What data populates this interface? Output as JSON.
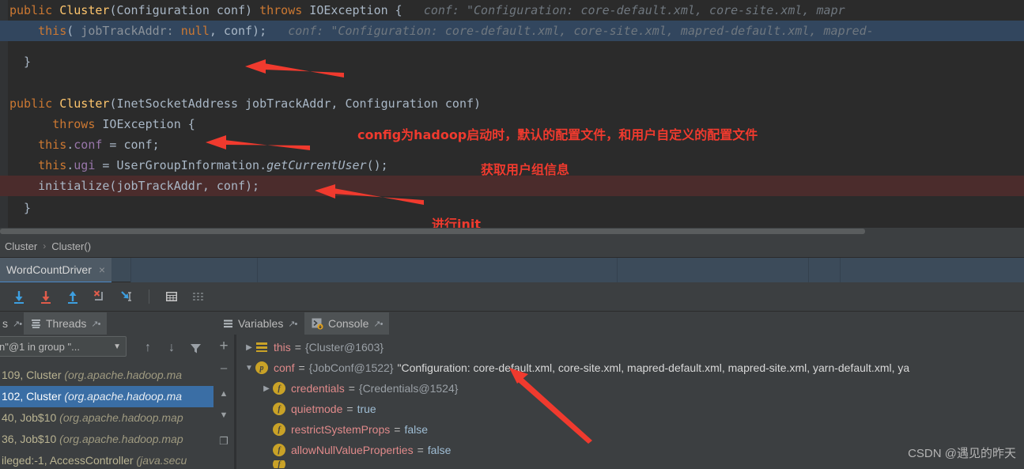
{
  "editor": {
    "lines": [
      {
        "id": "l1",
        "state": "normal",
        "text": "public Cluster(Configuration conf) throws IOException {"
      },
      {
        "id": "l2",
        "state": "selected",
        "text": "  this( jobTrackAddr: null, conf);"
      },
      {
        "id": "l3",
        "state": "normal",
        "text": "}"
      },
      {
        "id": "l4",
        "state": "normal",
        "text": ""
      },
      {
        "id": "l5",
        "state": "normal",
        "text": "public Cluster(InetSocketAddress jobTrackAddr, Configuration conf)"
      },
      {
        "id": "l6",
        "state": "normal",
        "text": "    throws IOException {"
      },
      {
        "id": "l7",
        "state": "normal",
        "text": "  this.conf = conf;"
      },
      {
        "id": "l8",
        "state": "normal",
        "text": "  this.ugi = UserGroupInformation.getCurrentUser();"
      },
      {
        "id": "l9",
        "state": "breakpoint",
        "text": "  initialize(jobTrackAddr, conf);"
      },
      {
        "id": "l10",
        "state": "normal",
        "text": "}"
      }
    ],
    "inline_hint_1": "conf: \"Configuration: core-default.xml, core-site.xml, mapr",
    "inline_hint_2": "conf: \"Configuration: core-default.xml, core-site.xml, mapred-default.xml, mapred-",
    "annotations": [
      {
        "id": "a1",
        "text": "config为hadoop启动时，默认的配置文件，和用户自定义的配置文件"
      },
      {
        "id": "a2",
        "text": "获取用户组信息"
      },
      {
        "id": "a3",
        "text": "进行init"
      }
    ]
  },
  "breadcrumb": {
    "items": [
      "Cluster",
      "Cluster()"
    ],
    "separator": "›"
  },
  "run_tab": {
    "label": "WordCountDriver",
    "close_icon": "×"
  },
  "debug_toolbar": {
    "buttons": [
      {
        "name": "step-over-icon",
        "glyph": "↓",
        "color": "#3d9fe0"
      },
      {
        "name": "step-into-icon",
        "glyph": "↓",
        "color": "#e05c4b"
      },
      {
        "name": "force-step-into-icon",
        "glyph": "↑",
        "color": "#3d9fe0"
      },
      {
        "name": "step-out-icon",
        "glyph": "✗",
        "color": "#e05c4b"
      },
      {
        "name": "run-to-cursor-icon",
        "glyph": "↘",
        "color": "#3d9fe0"
      },
      {
        "name": "evaluate-expression-icon",
        "glyph": "▦",
        "color": "#c4c4c4"
      },
      {
        "name": "trace-settings-icon",
        "glyph": "≡",
        "color": "#6f7477"
      }
    ]
  },
  "panel_tabs": [
    {
      "id": "frames-tab",
      "label": "s",
      "icon": "pin",
      "active": false
    },
    {
      "id": "threads-tab",
      "label": "Threads",
      "icon": "threads-icon",
      "active": true
    },
    {
      "id": "variables-tab",
      "label": "Variables",
      "icon": "variables-icon",
      "active": false
    },
    {
      "id": "console-tab",
      "label": "Console",
      "icon": "console-icon",
      "active": true
    }
  ],
  "frames": {
    "thread_selector_value": "n\"@1 in group \"...",
    "dropdown_icon": "▼",
    "toolbar_icons": [
      {
        "name": "frame-up-icon",
        "glyph": "↑"
      },
      {
        "name": "frame-down-icon",
        "glyph": "↓"
      },
      {
        "name": "filter-icon",
        "glyph": "∇"
      }
    ],
    "rows": [
      {
        "id": "f1",
        "selected": false,
        "text": "109, Cluster ",
        "pkg": "(org.apache.hadoop.ma"
      },
      {
        "id": "f2",
        "selected": true,
        "text": "102, Cluster ",
        "pkg": "(org.apache.hadoop.ma"
      },
      {
        "id": "f3",
        "selected": false,
        "text": "40, Job$10 ",
        "pkg": "(org.apache.hadoop.map"
      },
      {
        "id": "f4",
        "selected": false,
        "text": "36, Job$10 ",
        "pkg": "(org.apache.hadoop.map"
      },
      {
        "id": "f5",
        "selected": false,
        "text": "ileged:-1, AccessController ",
        "pkg": "(java.secu"
      }
    ]
  },
  "frames_side_toolbar": [
    {
      "name": "add-watch-icon",
      "glyph": "+"
    },
    {
      "name": "remove-watch-icon",
      "glyph": "–"
    },
    {
      "name": "move-up-icon",
      "glyph": "▲"
    },
    {
      "name": "move-down-icon",
      "glyph": "▼"
    },
    {
      "name": "copy-icon",
      "glyph": "❐"
    }
  ],
  "variables": {
    "rows": [
      {
        "id": "v1",
        "indent": 0,
        "twisty": "▶",
        "icon": "stack",
        "icon_letter": "",
        "name": "this",
        "eq": "=",
        "ref": "{Cluster@1603}",
        "str": ""
      },
      {
        "id": "v2",
        "indent": 0,
        "twisty": "▼",
        "icon": "p",
        "icon_letter": "p",
        "name": "conf",
        "eq": "=",
        "ref": "{JobConf@1522}",
        "str": "\"Configuration: core-default.xml, core-site.xml, mapred-default.xml, mapred-site.xml, yarn-default.xml, ya"
      },
      {
        "id": "v3",
        "indent": 1,
        "twisty": "▶",
        "icon": "f",
        "icon_letter": "f",
        "name": "credentials",
        "eq": "=",
        "ref": "{Credentials@1524}",
        "str": ""
      },
      {
        "id": "v4",
        "indent": 1,
        "twisty": "",
        "icon": "f",
        "icon_letter": "f",
        "name": "quietmode",
        "eq": "=",
        "ref": "",
        "bool": "true"
      },
      {
        "id": "v5",
        "indent": 1,
        "twisty": "",
        "icon": "f",
        "icon_letter": "f",
        "name": "restrictSystemProps",
        "eq": "=",
        "ref": "",
        "bool": "false"
      },
      {
        "id": "v6",
        "indent": 1,
        "twisty": "",
        "icon": "f",
        "icon_letter": "f",
        "name": "allowNullValueProperties",
        "eq": "=",
        "ref": "",
        "bool": "false"
      },
      {
        "id": "v7",
        "indent": 1,
        "twisty": "",
        "icon": "f",
        "icon_letter": "f",
        "name": "",
        "eq": "",
        "ref": "",
        "bool": ""
      }
    ]
  },
  "watermark": "CSDN @遇见的昨天",
  "colors": {
    "editor_bg": "#2b2b2b",
    "panel_bg": "#3c3f41",
    "selection_blue": "#32465e",
    "breakpoint_red": "#4b2c2c",
    "annotation_red": "#f03a2e",
    "frame_selected": "#3a6ea5",
    "tab_strip": "#3d4b58"
  }
}
